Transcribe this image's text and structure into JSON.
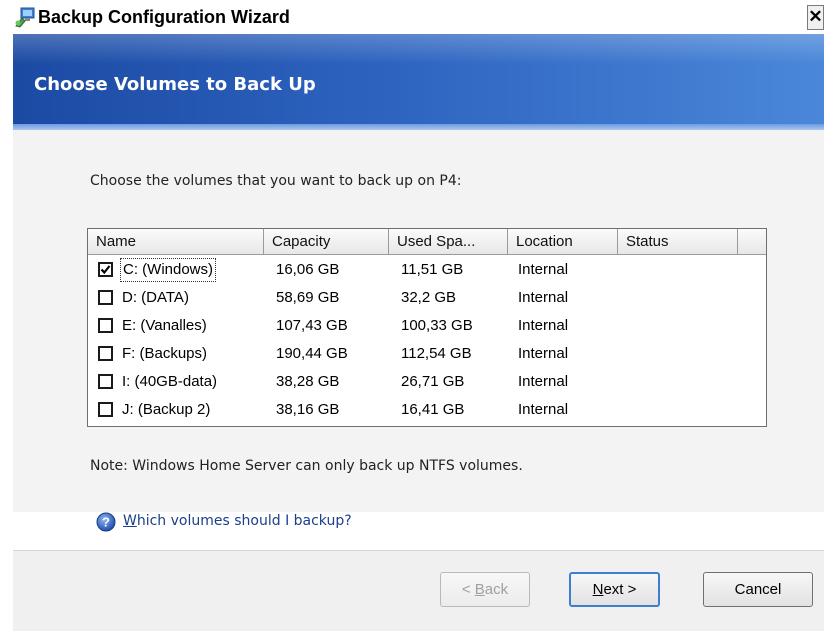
{
  "window": {
    "title": "Backup Configuration Wizard",
    "close_glyph": "✕"
  },
  "header": {
    "title": "Choose Volumes to Back Up"
  },
  "main": {
    "prompt": "Choose the volumes that you want to back up on P4:",
    "columns": [
      "Name",
      "Capacity",
      "Used Spa...",
      "Location",
      "Status"
    ],
    "rows": [
      {
        "checked": true,
        "name": "C: (Windows)",
        "capacity": "16,06 GB",
        "used": "11,51 GB",
        "location": "Internal",
        "status": ""
      },
      {
        "checked": false,
        "name": "D: (DATA)",
        "capacity": "58,69 GB",
        "used": "32,2 GB",
        "location": "Internal",
        "status": ""
      },
      {
        "checked": false,
        "name": "E: (Vanalles)",
        "capacity": "107,43 GB",
        "used": "100,33 GB",
        "location": "Internal",
        "status": ""
      },
      {
        "checked": false,
        "name": "F: (Backups)",
        "capacity": "190,44 GB",
        "used": "112,54 GB",
        "location": "Internal",
        "status": ""
      },
      {
        "checked": false,
        "name": "I: (40GB-data)",
        "capacity": "38,28 GB",
        "used": "26,71 GB",
        "location": "Internal",
        "status": ""
      },
      {
        "checked": false,
        "name": "J: (Backup 2)",
        "capacity": "38,16 GB",
        "used": "16,41 GB",
        "location": "Internal",
        "status": ""
      }
    ],
    "note": "Note: Windows Home Server can only back up NTFS volumes.",
    "help_link": {
      "first_letter": "W",
      "rest": "hich volumes should I backup?"
    }
  },
  "footer": {
    "back": {
      "prefix": "< ",
      "accel": "B",
      "rest": "ack"
    },
    "next": {
      "accel": "N",
      "rest": "ext >"
    },
    "cancel": "Cancel"
  },
  "colors": {
    "banner_start": "#1b4aa3",
    "banner_end": "#4a87d9",
    "link": "#1a3f8c",
    "default_button_border": "#3c7fd1"
  },
  "icons": {
    "title": "wizard-computer-icon",
    "help": "question-circle-icon",
    "check": "checkmark-icon"
  }
}
